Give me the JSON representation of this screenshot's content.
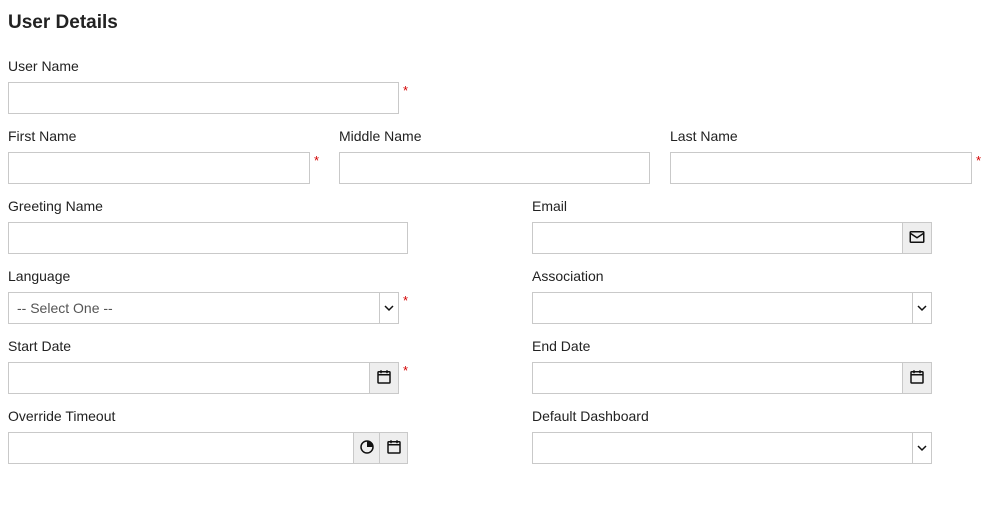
{
  "title": "User Details",
  "fields": {
    "userName": {
      "label": "User Name",
      "value": "",
      "required": true
    },
    "firstName": {
      "label": "First Name",
      "value": "",
      "required": true
    },
    "middleName": {
      "label": "Middle Name",
      "value": "",
      "required": false
    },
    "lastName": {
      "label": "Last Name",
      "value": "",
      "required": true
    },
    "greeting": {
      "label": "Greeting Name",
      "value": "",
      "required": false
    },
    "email": {
      "label": "Email",
      "value": "",
      "required": false
    },
    "language": {
      "label": "Language",
      "value": "-- Select One --",
      "required": true
    },
    "association": {
      "label": "Association",
      "value": "",
      "required": false
    },
    "startDate": {
      "label": "Start Date",
      "value": "",
      "required": true
    },
    "endDate": {
      "label": "End Date",
      "value": "",
      "required": false
    },
    "override": {
      "label": "Override Timeout",
      "value": "",
      "required": false
    },
    "dashboard": {
      "label": "Default Dashboard",
      "value": "",
      "required": false
    }
  },
  "requiredMark": "*"
}
